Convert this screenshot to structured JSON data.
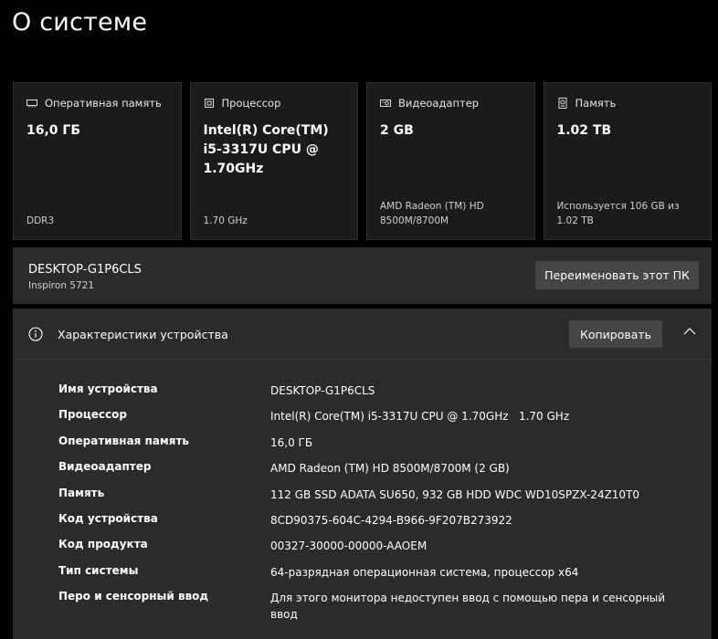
{
  "page": {
    "title": "О системе"
  },
  "cards": [
    {
      "icon": "memory-icon",
      "label": "Оперативная память",
      "value": "16,0 ГБ",
      "footer": "DDR3"
    },
    {
      "icon": "processor-icon",
      "label": "Процессор",
      "value": "Intel(R) Core(TM) i5-3317U CPU @ 1.70GHz",
      "footer": "1.70 GHz"
    },
    {
      "icon": "display-adapter-icon",
      "label": "Видеоадаптер",
      "value": "2 GB",
      "footer": "AMD Radeon (TM) HD 8500M/8700M"
    },
    {
      "icon": "storage-icon",
      "label": "Память",
      "value": "1.02 TB",
      "footer": "Используется 106 GB из 1.02 TB"
    }
  ],
  "pc": {
    "name": "DESKTOP-G1P6CLS",
    "model": "Inspiron 5721",
    "rename_label": "Переименовать этот ПК"
  },
  "specs": {
    "title": "Характеристики устройства",
    "copy_label": "Копировать",
    "rows": [
      {
        "label": "Имя устройства",
        "value": "DESKTOP-G1P6CLS"
      },
      {
        "label": "Процессор",
        "value": "Intel(R) Core(TM) i5-3317U CPU @ 1.70GHz   1.70 GHz"
      },
      {
        "label": "Оперативная память",
        "value": "16,0 ГБ"
      },
      {
        "label": "Видеоадаптер",
        "value": "AMD Radeon (TM) HD 8500M/8700M (2 GB)"
      },
      {
        "label": "Память",
        "value": "112 GB SSD ADATA SU650, 932 GB HDD WDC WD10SPZX-24Z10T0"
      },
      {
        "label": "Код устройства",
        "value": "8CD90375-604C-4294-B966-9F207B273922"
      },
      {
        "label": "Код продукта",
        "value": "00327-30000-00000-AAOEM"
      },
      {
        "label": "Тип системы",
        "value": "64-разрядная операционная система, процессор x64"
      },
      {
        "label": "Перо и сенсорный ввод",
        "value": "Для этого монитора недоступен ввод с помощью пера и сенсорный ввод"
      }
    ]
  }
}
